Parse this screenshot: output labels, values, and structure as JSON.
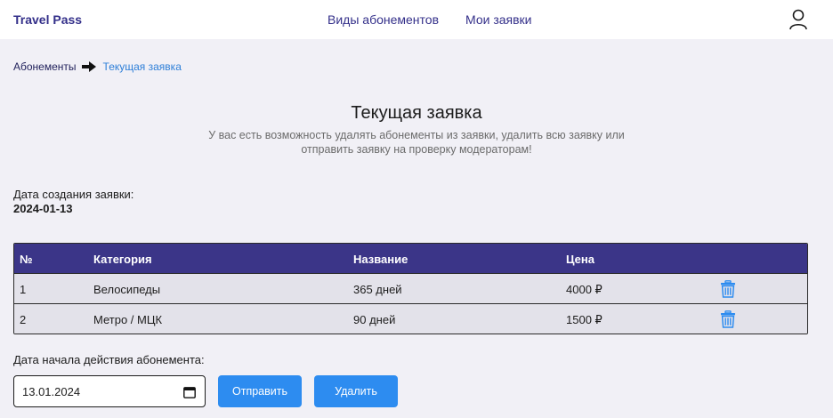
{
  "header": {
    "brand": "Travel Pass",
    "nav": [
      "Виды абонементов",
      "Мои заявки"
    ]
  },
  "breadcrumb": {
    "items": [
      "Абонементы",
      "Текущая заявка"
    ]
  },
  "page": {
    "title": "Текущая заявка",
    "subtitle": "У вас есть возможность удалять абонементы из заявки, удалить всю заявку или отправить заявку на проверку модераторам!",
    "created_label": "Дата создания заявки:",
    "created_value": "2024-01-13"
  },
  "table": {
    "headers": [
      "№",
      "Категория",
      "Название",
      "Цена"
    ],
    "rows": [
      [
        "1",
        "Велосипеды",
        "365 дней",
        "4000 ₽"
      ],
      [
        "2",
        "Метро / МЦК",
        "90 дней",
        "1500 ₽"
      ]
    ]
  },
  "form": {
    "start_label": "Дата начала действия абонемента:",
    "start_value": "13.01.2024",
    "send_label": "Отправить",
    "delete_label": "Удалить"
  },
  "colors": {
    "brand": "#34308a",
    "table_header": "#3b3588",
    "accent": "#2d8cf0",
    "link": "#2e7fd8"
  }
}
